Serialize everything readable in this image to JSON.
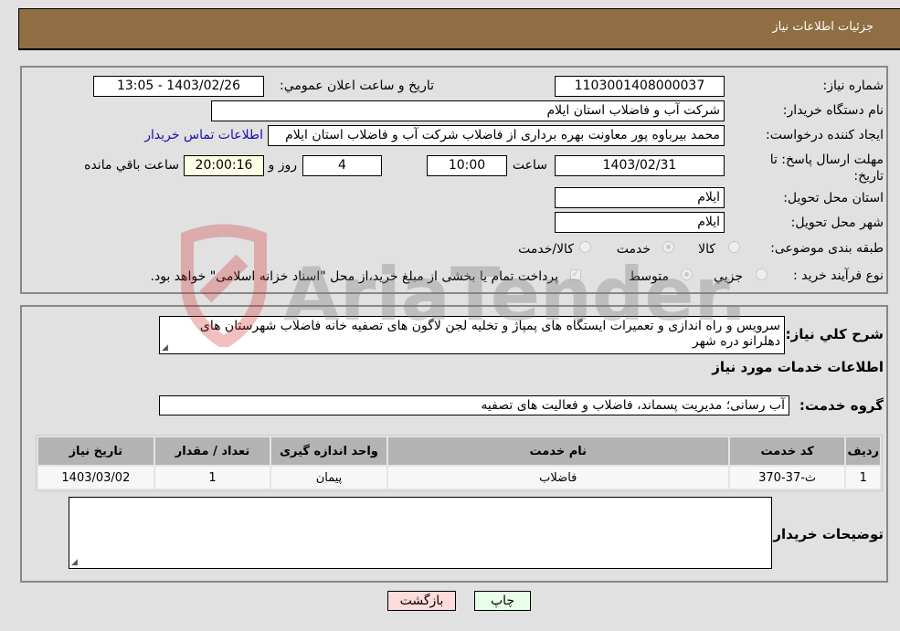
{
  "header": {
    "title": "جزئیات اطلاعات نیاز"
  },
  "form": {
    "need_number": {
      "label": "شماره نیاز:",
      "value": "1103001408000037"
    },
    "announce_datetime": {
      "label": "تاریخ و ساعت اعلان عمومي:",
      "value": "1403/02/26 - 13:05"
    },
    "buyer_org": {
      "label": "نام دستگاه خریدار:",
      "value": "شرکت آب و فاضلاب استان ایلام"
    },
    "requester": {
      "label": "ایجاد کننده درخواست:",
      "value": "محمد بیرباوه پور معاونت بهره برداری از فاضلاب شرکت آب و فاضلاب استان ایلام",
      "contact_link": "اطلاعات تماس خریدار"
    },
    "deadline": {
      "label": "مهلت ارسال پاسخ: تا تاریخ:",
      "date": "1403/02/31",
      "time_label": "ساعت",
      "time": "10:00",
      "days": "4",
      "days_label": "روز و",
      "remaining": "20:00:16",
      "remaining_label": "ساعت باقي مانده"
    },
    "delivery_province": {
      "label": "استان محل تحویل:",
      "value": "ایلام"
    },
    "delivery_city": {
      "label": "شهر محل تحویل:",
      "value": "ایلام"
    },
    "subject_category": {
      "label": "طبقه بندی موضوعی:",
      "options": [
        "کالا",
        "خدمت",
        "کالا/خدمت"
      ],
      "selected": "خدمت"
    },
    "purchase_type": {
      "label": "نوع فرآیند خرید :",
      "options": [
        "جزيي",
        "متوسط"
      ],
      "selected": "متوسط",
      "treasury_note": "پرداخت تمام یا بخشی از مبلغ خرید،از محل \"اسناد خزانه اسلامی\" خواهد بود."
    }
  },
  "description": {
    "label": "شرح کلي نیاز:",
    "value": "سرویس و راه اندازی و تعمیرات ایستگاه های پمپاژ و تخلیه لجن لاگون های تصفیه خانه فاضلاب شهرستان های دهلرانو دره شهر"
  },
  "services_section": {
    "title": "اطلاعات خدمات مورد نیاز",
    "group_label": "گروه خدمت:",
    "group_value": "آب رسانی؛ مدیریت پسماند، فاضلاب و فعالیت های تصفیه",
    "table": {
      "headers": [
        "ردیف",
        "کد خدمت",
        "نام خدمت",
        "واحد اندازه گیری",
        "تعداد / مقدار",
        "تاریخ نیاز"
      ],
      "rows": [
        [
          "1",
          "ث-37-370",
          "فاضلاب",
          "پیمان",
          "1",
          "1403/03/02"
        ]
      ]
    }
  },
  "buyer_notes": {
    "label": "توضیحات خریدار:",
    "value": ""
  },
  "buttons": {
    "print": "چاپ",
    "back": "بازگشت"
  },
  "watermark": {
    "text": "AriaTender.neT"
  },
  "colors": {
    "header": "#8e6e42",
    "countdown_bg": "#ffffe6",
    "back_button": "#ffdcdc",
    "print_button": "#e8ffe8",
    "link": "#1a0dab"
  }
}
